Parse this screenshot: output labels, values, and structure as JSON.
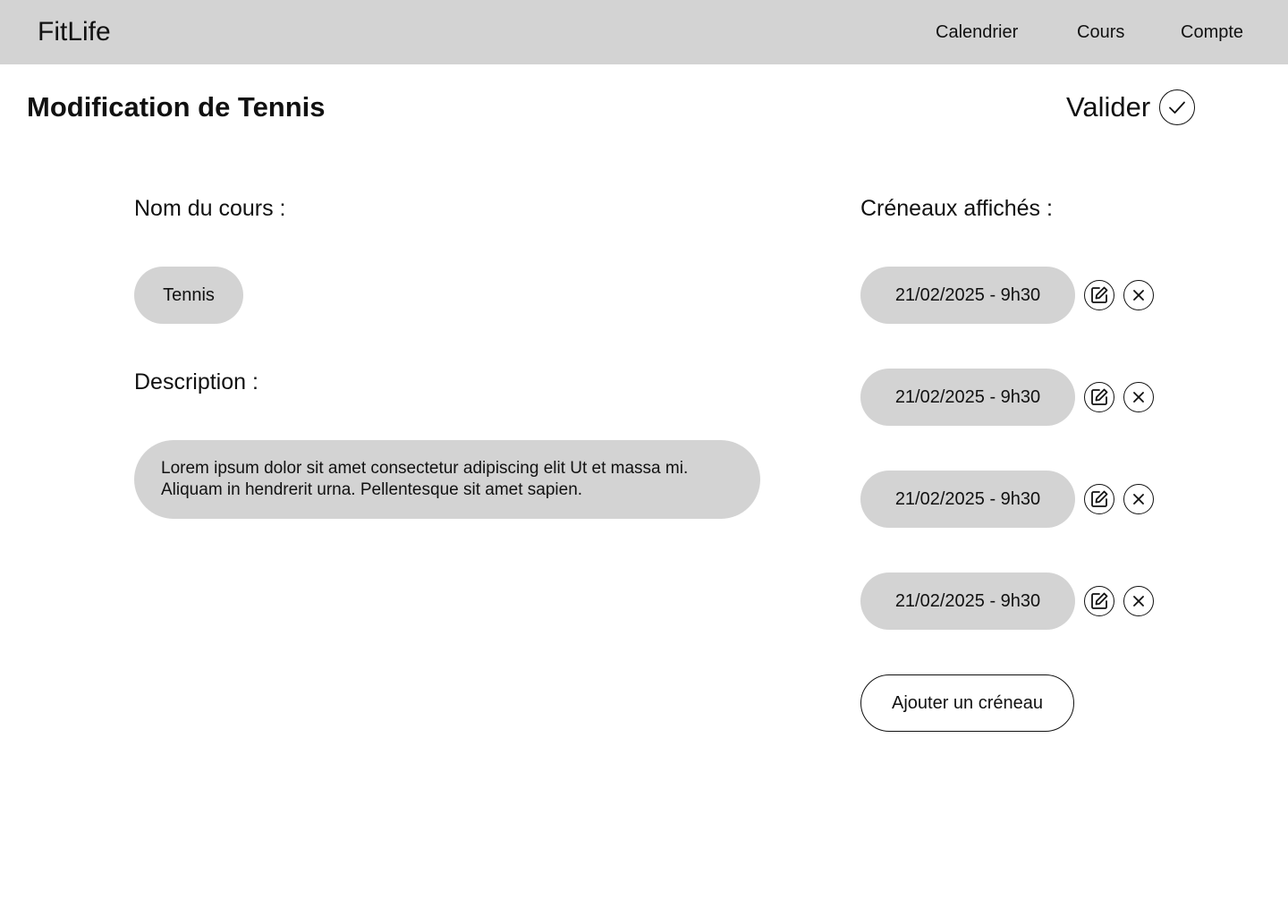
{
  "app": {
    "brand": "FitLife",
    "nav": [
      "Calendrier",
      "Cours",
      "Compte"
    ]
  },
  "page": {
    "title": "Modification de Tennis",
    "validate_label": "Valider"
  },
  "form": {
    "name_label": "Nom du cours :",
    "name_value": "Tennis",
    "description_label": "Description :",
    "description_value": "Lorem ipsum dolor sit amet consectetur adipiscing elit Ut et massa mi. Aliquam in hendrerit urna. Pellentesque sit amet sapien."
  },
  "slots": {
    "label": "Créneaux affichés :",
    "items": [
      "21/02/2025 - 9h30",
      "21/02/2025 - 9h30",
      "21/02/2025 - 9h30",
      "21/02/2025 - 9h30"
    ],
    "add_label": "Ajouter un créneau"
  },
  "icons": {
    "validate": "check-circle-icon",
    "edit": "edit-icon",
    "delete": "close-icon"
  },
  "colors": {
    "navbar_bg": "#d3d3d3",
    "pill_bg": "#d3d3d3",
    "text": "#111111",
    "background": "#ffffff"
  }
}
